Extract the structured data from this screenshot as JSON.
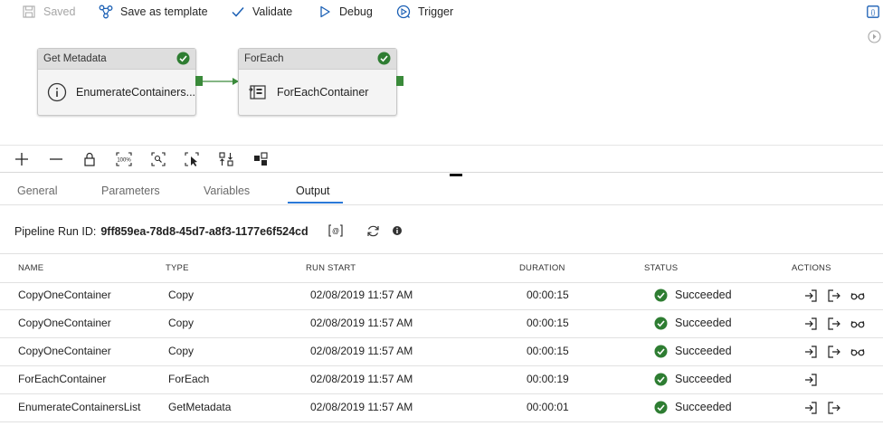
{
  "toolbar": {
    "saved_label": "Saved",
    "save_template_label": "Save as template",
    "validate_label": "Validate",
    "debug_label": "Debug",
    "trigger_label": "Trigger"
  },
  "pipeline": {
    "activities": [
      {
        "type_label": "Get Metadata",
        "name": "EnumerateContainers...",
        "status": "succeeded"
      },
      {
        "type_label": "ForEach",
        "name": "ForEachContainer",
        "status": "succeeded"
      }
    ]
  },
  "tabs": [
    {
      "label": "General"
    },
    {
      "label": "Parameters"
    },
    {
      "label": "Variables"
    },
    {
      "label": "Output"
    }
  ],
  "active_tab": "Output",
  "run": {
    "label": "Pipeline Run ID:",
    "id": "9ff859ea-78d8-45d7-a8f3-1177e6f524cd"
  },
  "table": {
    "columns": [
      "NAME",
      "TYPE",
      "RUN START",
      "DURATION",
      "STATUS",
      "ACTIONS"
    ],
    "rows": [
      {
        "name": "CopyOneContainer",
        "type": "Copy",
        "run_start": "02/08/2019 11:57 AM",
        "duration": "00:00:15",
        "status": "Succeeded",
        "actions": [
          "input",
          "output",
          "details"
        ]
      },
      {
        "name": "CopyOneContainer",
        "type": "Copy",
        "run_start": "02/08/2019 11:57 AM",
        "duration": "00:00:15",
        "status": "Succeeded",
        "actions": [
          "input",
          "output",
          "details"
        ]
      },
      {
        "name": "CopyOneContainer",
        "type": "Copy",
        "run_start": "02/08/2019 11:57 AM",
        "duration": "00:00:15",
        "status": "Succeeded",
        "actions": [
          "input",
          "output",
          "details"
        ]
      },
      {
        "name": "ForEachContainer",
        "type": "ForEach",
        "run_start": "02/08/2019 11:57 AM",
        "duration": "00:00:19",
        "status": "Succeeded",
        "actions": [
          "input"
        ]
      },
      {
        "name": "EnumerateContainersList",
        "type": "GetMetadata",
        "run_start": "02/08/2019 11:57 AM",
        "duration": "00:00:01",
        "status": "Succeeded",
        "actions": [
          "input",
          "output"
        ]
      }
    ]
  },
  "colors": {
    "success": "#2e7d32",
    "accent": "#2b79d8",
    "port": "#3a8a3a"
  }
}
